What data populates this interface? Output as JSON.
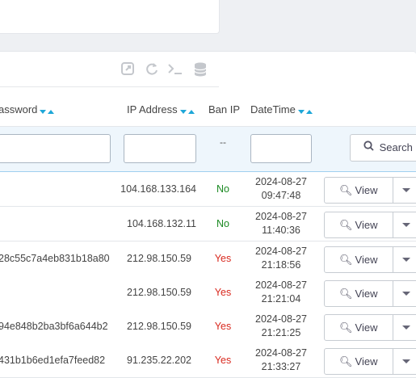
{
  "table": {
    "columns": {
      "password": "assword",
      "ip_address": "IP Address",
      "ban_ip": "Ban IP",
      "datetime": "DateTime"
    },
    "ban_filter": "--",
    "search_label": "Search",
    "rows": [
      {
        "password": "",
        "ip": "104.168.133.164",
        "ban": "No",
        "date": "2024-08-27",
        "time": "09:47:48"
      },
      {
        "password": "",
        "ip": "104.168.132.11",
        "ban": "No",
        "date": "2024-08-27",
        "time": "11:40:36"
      },
      {
        "password": "28c55c7a4eb831b18a80",
        "ip": "212.98.150.59",
        "ban": "Yes",
        "date": "2024-08-27",
        "time": "21:18:56"
      },
      {
        "password": "",
        "ip": "212.98.150.59",
        "ban": "Yes",
        "date": "2024-08-27",
        "time": "21:21:04"
      },
      {
        "password": "94e848b2ba3bf6a644b2",
        "ip": "212.98.150.59",
        "ban": "Yes",
        "date": "2024-08-27",
        "time": "21:21:25"
      },
      {
        "password": "431b1b6ed1efa7feed82",
        "ip": "91.235.22.202",
        "ban": "Yes",
        "date": "2024-08-27",
        "time": "21:33:27"
      }
    ],
    "view_label": "View"
  },
  "toolbar": {
    "icons": [
      "external-link-icon",
      "refresh-icon",
      "terminal-icon",
      "database-icon"
    ]
  },
  "colors": {
    "yes": "#d9291f",
    "no": "#1c8a23",
    "sort_arrow": "#1ea7d8"
  }
}
